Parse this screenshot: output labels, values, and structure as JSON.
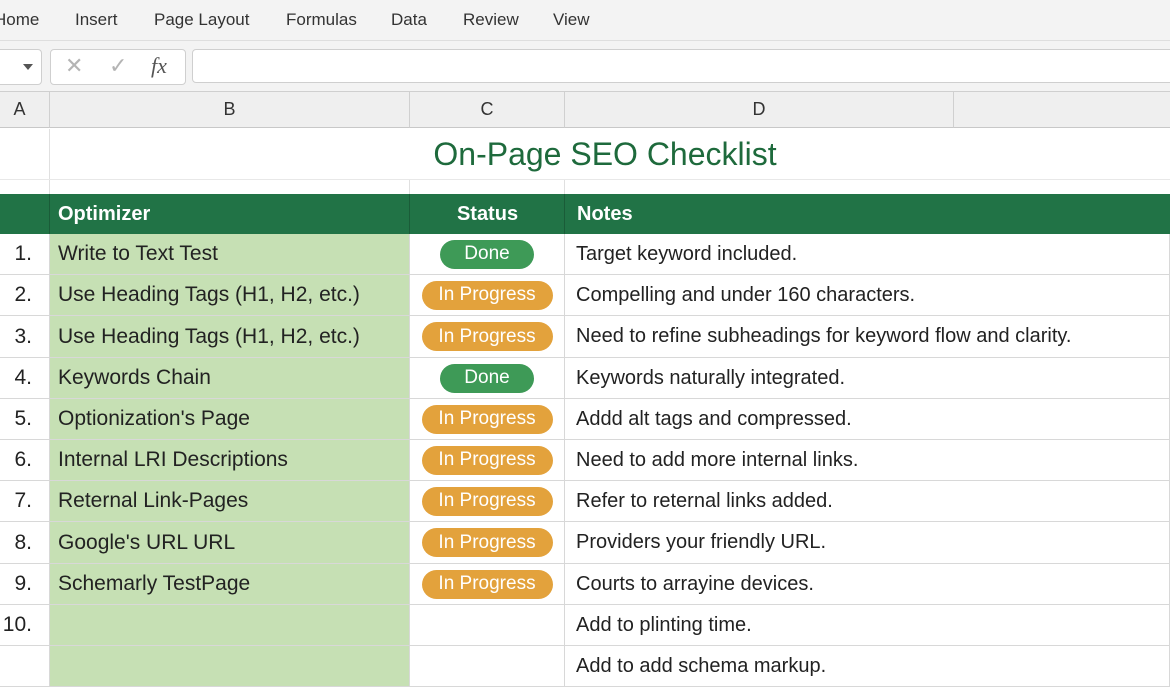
{
  "ribbon": {
    "tabs": [
      "Home",
      "Insert",
      "Page Layout",
      "Formulas",
      "Data",
      "Review",
      "View"
    ]
  },
  "formula_bar": {
    "fx_label": "fx",
    "cancel_glyph": "✕",
    "enter_glyph": "✓",
    "value": ""
  },
  "columns": [
    "A",
    "B",
    "C",
    "D"
  ],
  "sheet": {
    "title": "On-Page SEO Checklist",
    "headers": {
      "optimizer": "Optimizer",
      "status": "Status",
      "notes": "Notes"
    },
    "rows": [
      {
        "num": "1.",
        "optimizer": "Write to Text Test",
        "status": "Done",
        "notes": "Target keyword included."
      },
      {
        "num": "2.",
        "optimizer": "Use Heading Tags (H1, H2, etc.)",
        "status": "In Progress",
        "notes": "Compelling and under 160 characters."
      },
      {
        "num": "3.",
        "optimizer": "Use Heading Tags (H1, H2, etc.)",
        "status": "In Progress",
        "notes": "Need to refine subheadings for keyword flow and clarity."
      },
      {
        "num": "4.",
        "optimizer": "Keywords Chain",
        "status": "Done",
        "notes": "Keywords naturally integrated."
      },
      {
        "num": "5.",
        "optimizer": "Optionization's Page",
        "status": "In Progress",
        "notes": "Addd alt tags and compressed."
      },
      {
        "num": "6.",
        "optimizer": "Internal LRI Descriptions",
        "status": "In Progress",
        "notes": "Need to add more internal links."
      },
      {
        "num": "7.",
        "optimizer": "Reternal Link-Pages",
        "status": "In Progress",
        "notes": "Refer to reternal links added."
      },
      {
        "num": "8.",
        "optimizer": "Google's URL URL",
        "status": "In Progress",
        "notes": "Providers your friendly URL."
      },
      {
        "num": "9.",
        "optimizer": "Schemarly TestPage",
        "status": "In Progress",
        "notes": "Courts to arrayine devices."
      },
      {
        "num": "10.",
        "optimizer": "",
        "status": "",
        "notes": "Add to plinting time."
      },
      {
        "num": "",
        "optimizer": "",
        "status": "",
        "notes": "Add to add schema markup."
      }
    ]
  },
  "colors": {
    "header_green": "#217346",
    "title_green": "#1e6a3c",
    "optimizer_fill": "#c6e0b4",
    "done_pill": "#3e9a57",
    "progress_pill": "#e3a23c"
  }
}
